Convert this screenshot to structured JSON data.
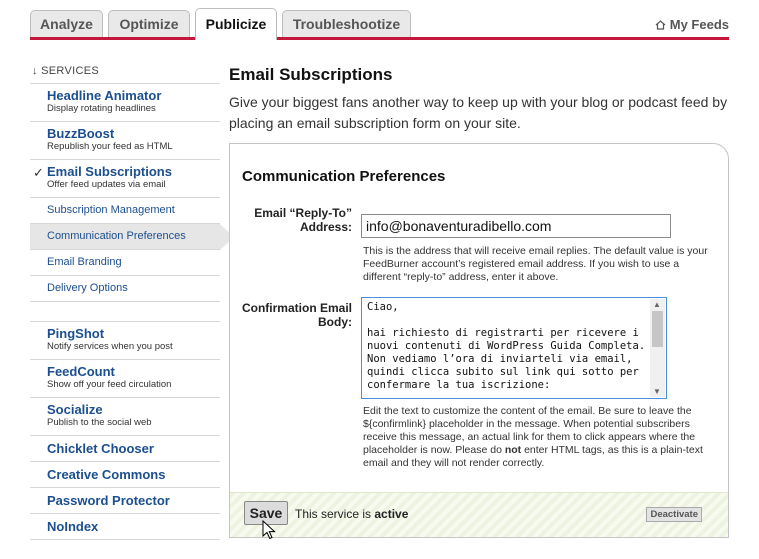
{
  "tabs": [
    {
      "label": "Analyze",
      "active": false
    },
    {
      "label": "Optimize",
      "active": false
    },
    {
      "label": "Publicize",
      "active": true
    },
    {
      "label": "Troubleshootize",
      "active": false
    }
  ],
  "my_feeds": "My Feeds",
  "sidebar": {
    "header": "↓ SERVICES",
    "check_mark": "✓",
    "items": [
      {
        "title": "Headline Animator",
        "desc": "Display rotating headlines"
      },
      {
        "title": "BuzzBoost",
        "desc": "Republish your feed as HTML"
      },
      {
        "title": "Email Subscriptions",
        "desc": "Offer feed updates via email",
        "checked": true
      },
      {
        "title": "Subscription Management"
      },
      {
        "title": "Communication Preferences",
        "current": true
      },
      {
        "title": "Email Branding"
      },
      {
        "title": "Delivery Options"
      },
      {
        "title": "PingShot",
        "desc": "Notify services when you post"
      },
      {
        "title": "FeedCount",
        "desc": "Show off your feed circulation"
      },
      {
        "title": "Socialize",
        "desc": "Publish to the social web"
      },
      {
        "title": "Chicklet Chooser"
      },
      {
        "title": "Creative Commons"
      },
      {
        "title": "Password Protector"
      },
      {
        "title": "NoIndex"
      }
    ]
  },
  "main": {
    "title": "Email Subscriptions",
    "intro": "Give your biggest fans another way to keep up with your blog or podcast feed by placing an email subscription form on your site.",
    "panel": {
      "title": "Communication Preferences",
      "reply_to": {
        "label_line1": "Email “Reply-To”",
        "label_line2": "Address:",
        "value": "info@bonaventuradibello.com",
        "help": "This is the address that will receive email replies. The default value is your FeedBurner account’s registered email address. If you wish to use a different “reply-to” address, enter it above."
      },
      "body": {
        "label_line1": "Confirmation Email",
        "label_line2": "Body:",
        "value": "Ciao,\n\nhai richiesto di registrarti per ricevere i nuovi contenuti di WordPress Guida Completa. Non vediamo l’ora di inviarteli via email, quindi clicca subito sul link qui sotto per confermare la tua iscrizione:",
        "help_before_not": "Edit the text to customize the content of the email. Be sure to leave the ${confirmlink} placeholder in the message. When potential subscribers receive this message, an actual link for them to click appears where the placeholder is now. Please do ",
        "help_not": "not",
        "help_after_not": " enter HTML tags, as this is a plain-text email and they will not render correctly."
      },
      "footer": {
        "save_label": "Save",
        "status_prefix": "This service is ",
        "status_value": "active",
        "deactivate_label": "Deactivate"
      }
    }
  },
  "colors": {
    "accent_red": "#c4173b",
    "link_blue": "#1c4f8f",
    "focus_blue": "#4a90d9"
  }
}
